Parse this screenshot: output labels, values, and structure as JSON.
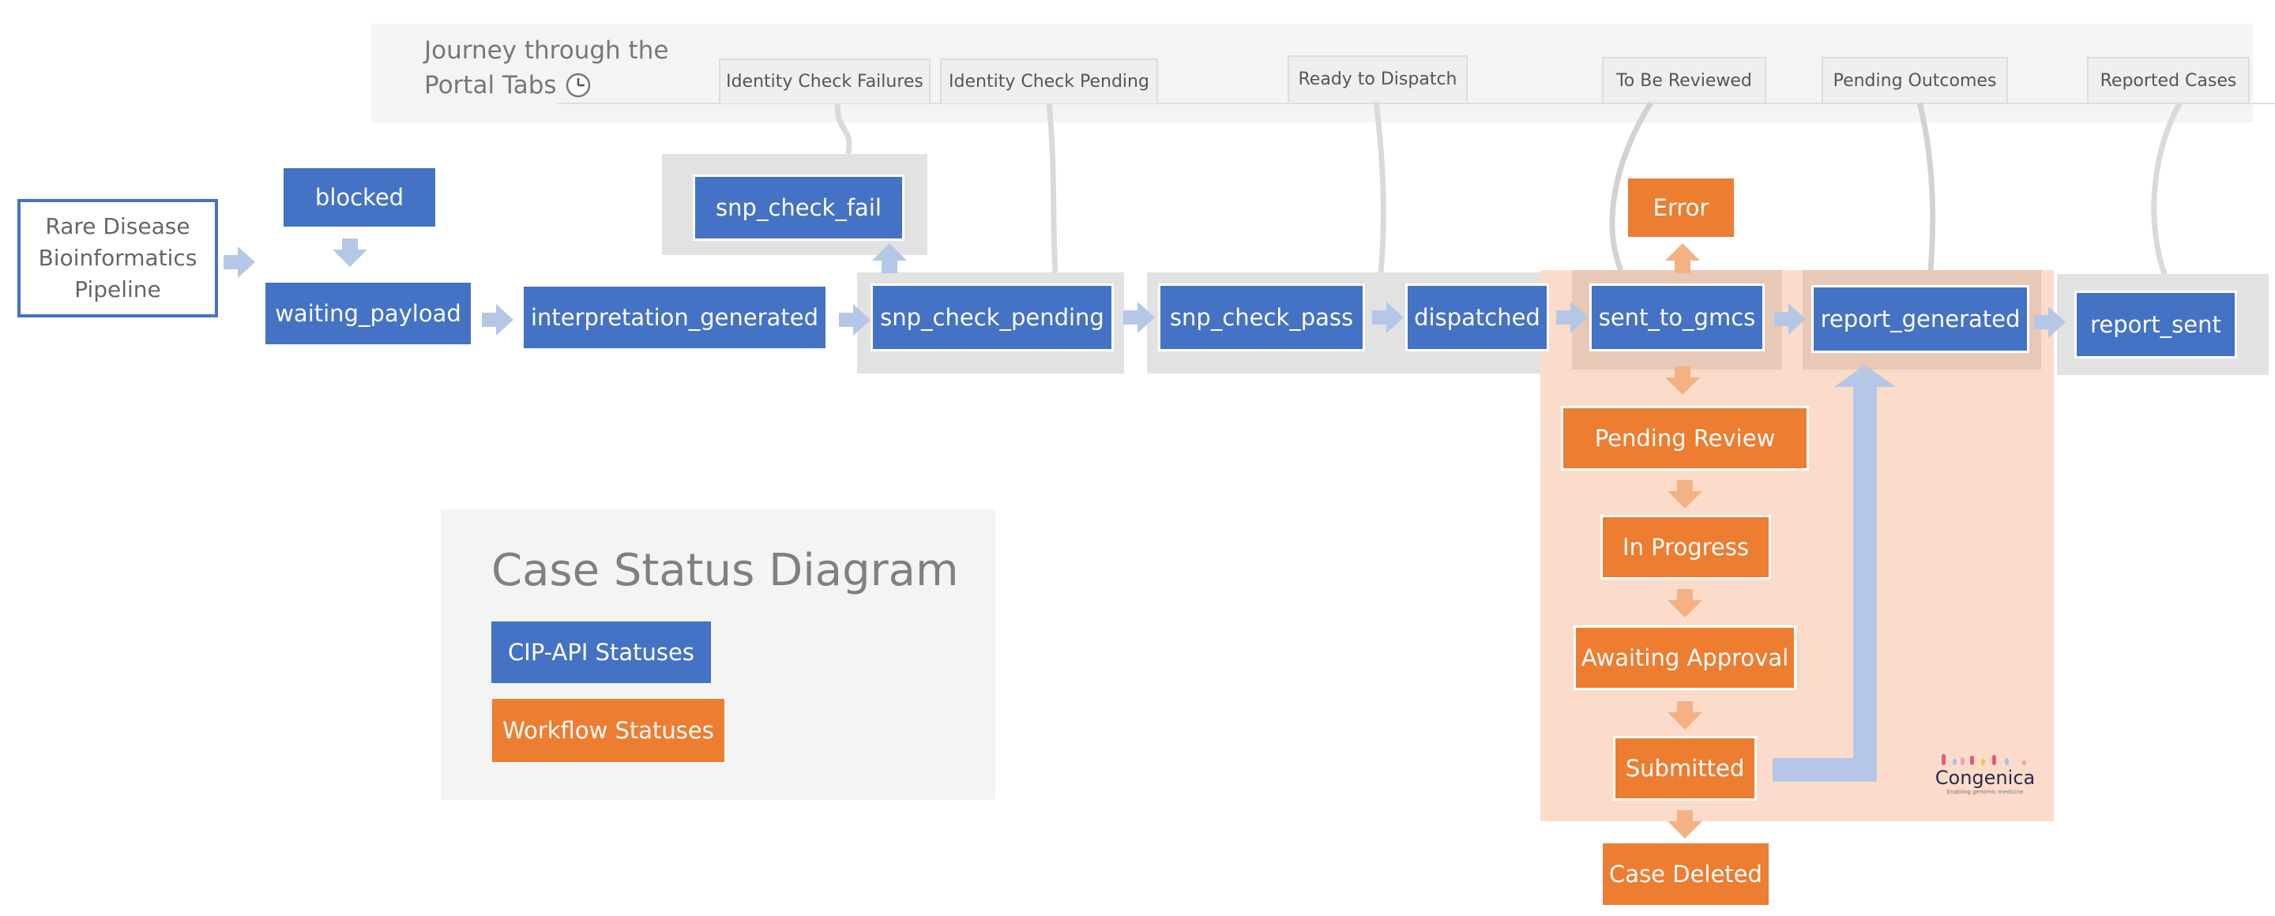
{
  "header": {
    "title_line1": "Journey through the",
    "title_line2": "Portal Tabs",
    "clock_icon": "clock-icon"
  },
  "tabs": [
    "Identity Check Failures",
    "Identity Check Pending",
    "Ready to Dispatch",
    "To Be Reviewed",
    "Pending Outcomes",
    "Reported Cases"
  ],
  "pipeline": {
    "label": "Rare Disease\nBioinformatics\nPipeline"
  },
  "cip_statuses": {
    "blocked": "blocked",
    "waiting_payload": "waiting_payload",
    "interpretation_generated": "interpretation_generated",
    "snp_check_fail": "snp_check_fail",
    "snp_check_pending": "snp_check_pending",
    "snp_check_pass": "snp_check_pass",
    "dispatched": "dispatched",
    "sent_to_gmcs": "sent_to_gmcs",
    "report_generated": "report_generated",
    "report_sent": "report_sent"
  },
  "workflow_statuses": {
    "error": "Error",
    "pending_review": "Pending Review",
    "in_progress": "In Progress",
    "awaiting_approval": "Awaiting Approval",
    "submitted": "Submitted",
    "case_deleted": "Case Deleted"
  },
  "legend": {
    "title": "Case Status Diagram",
    "cip_label": "CIP-API Statuses",
    "workflow_label": "Workflow Statuses"
  },
  "logo": {
    "text": "Congenica",
    "tagline": "Enabling genomic medicine"
  },
  "colors": {
    "cip_blue": "#4472c4",
    "workflow_orange": "#ed7d31",
    "arrow_blue": "#b4c7e7",
    "arrow_orange": "#f4b183",
    "workflow_region": "#fbdccb"
  }
}
